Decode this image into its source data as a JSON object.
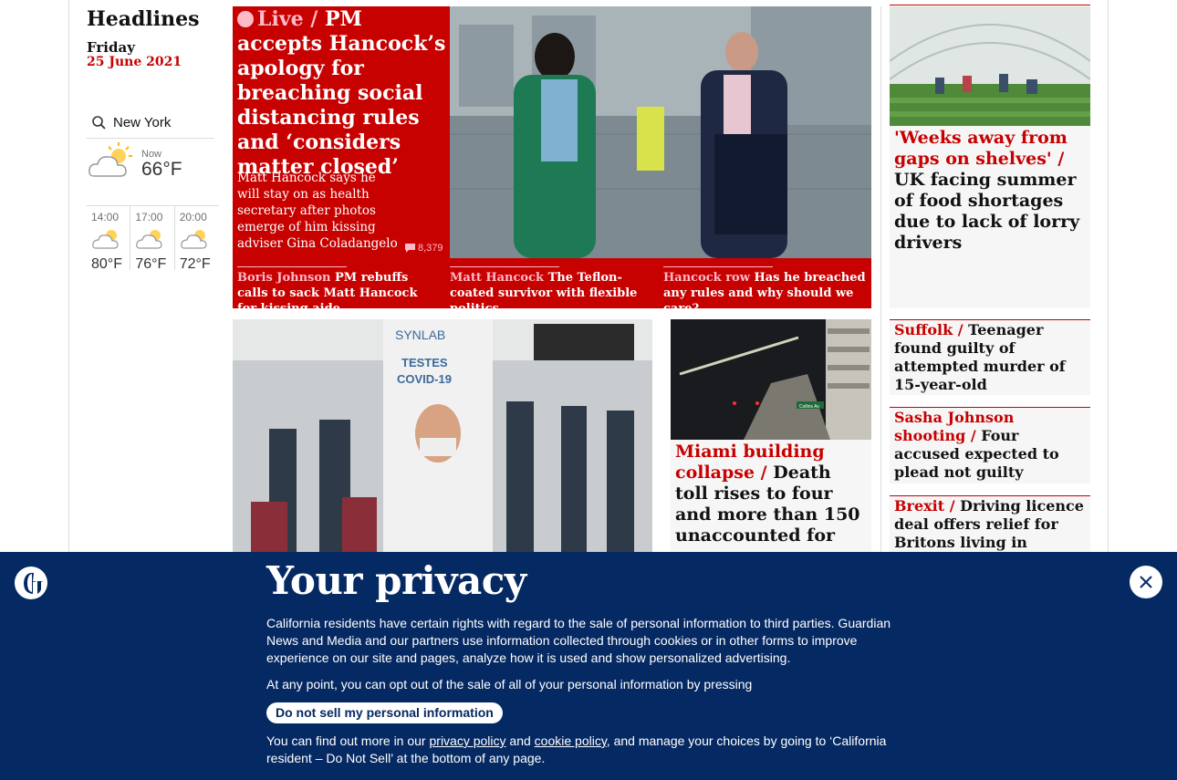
{
  "section": {
    "title": "Headlines",
    "day": "Friday",
    "date": "25 June 2021"
  },
  "weather": {
    "location": "New York",
    "now_label": "Now",
    "now_temp": "66°F",
    "forecast": [
      {
        "time": "14:00",
        "temp": "80°F"
      },
      {
        "time": "17:00",
        "temp": "76°F"
      },
      {
        "time": "20:00",
        "temp": "72°F"
      }
    ]
  },
  "lead": {
    "kicker": "Live /",
    "headline": "PM accepts Hancock’s apology for breaching social distancing rules and ‘considers matter closed’",
    "standfirst": "Matt Hancock says he will stay on as health secretary after photos emerge of him kissing adviser Gina Coladangelo",
    "comments": "8,379",
    "sublinks": [
      {
        "kicker": "Boris Johnson",
        "text": "PM rebuffs calls to sack Matt Hancock for kissing aide"
      },
      {
        "kicker": "Matt Hancock",
        "text": "The Teflon-coated survivor with flexible politics"
      },
      {
        "kicker": "Hancock row",
        "text": "Has he breached any rules and why should we care?"
      }
    ]
  },
  "image_text": {
    "brand": "SYNLAB",
    "sign1": "TESTES",
    "sign2": "COVID-19",
    "street": "Collins Av"
  },
  "miami": {
    "kicker": "Miami building collapse /",
    "text": "Death toll rises to four and more than 150 unaccounted for"
  },
  "food": {
    "kicker": "'Weeks away from gaps on shelves'  /",
    "text": "UK facing summer of food shortages due to lack of lorry drivers"
  },
  "right_items": [
    {
      "kicker": "Suffolk /",
      "text": "Teenager found guilty of attempted murder of 15-year-old"
    },
    {
      "kicker": "Sasha Johnson shooting /",
      "text": "Four accused expected to plead not guilty"
    },
    {
      "kicker": "Brexit /",
      "text": "Driving licence deal offers relief for Britons living in France"
    }
  ],
  "privacy": {
    "title": "Your privacy",
    "para1": "California residents have certain rights with regard to the sale of personal information to third parties. Guardian News and Media and our partners use information collected through cookies or in other forms to improve experience on our site and pages, analyze how it is used and show personalized advertising.",
    "para2": "At any point, you can opt out of the sale of all of your personal information by pressing",
    "button": "Do not sell my personal information",
    "para3_start": "You can find out more in our",
    "privacy_link": "privacy policy",
    "and": "and",
    "cookie_link": "cookie policy",
    "para3_end": ", and manage your choices by going to ‘California resident – Do Not Sell’ at the bottom of any page."
  },
  "colors": {
    "brand_red": "#c70000",
    "navy": "#052962",
    "pink": "#ffbac8"
  }
}
